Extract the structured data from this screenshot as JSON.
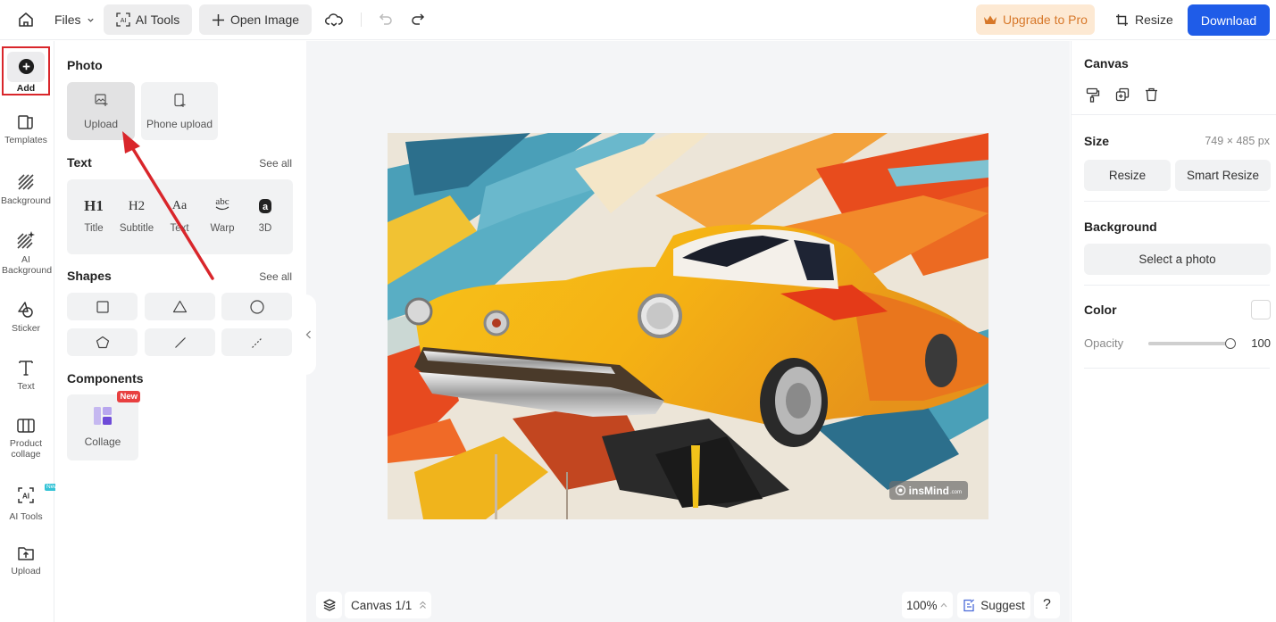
{
  "topbar": {
    "home_icon": "home-icon",
    "files_label": "Files",
    "ai_tools_label": "AI Tools",
    "open_image_label": "Open Image",
    "upgrade_label": "Upgrade to Pro",
    "resize_label": "Resize",
    "download_label": "Download"
  },
  "rail": {
    "items": [
      {
        "label": "Add",
        "icon": "add-circle-icon"
      },
      {
        "label": "Templates",
        "icon": "templates-icon"
      },
      {
        "label": "Background",
        "icon": "background-hatch-icon"
      },
      {
        "label": "AI Background",
        "icon": "ai-background-icon"
      },
      {
        "label": "Sticker",
        "icon": "sticker-icon"
      },
      {
        "label": "Text",
        "icon": "text-icon"
      },
      {
        "label": "Product collage",
        "icon": "product-collage-icon"
      },
      {
        "label": "AI Tools",
        "icon": "ai-tools-icon",
        "badge": "New"
      },
      {
        "label": "Upload",
        "icon": "upload-folder-icon"
      }
    ]
  },
  "panel": {
    "photo": {
      "title": "Photo",
      "items": [
        {
          "label": "Upload",
          "icon": "image-upload-icon"
        },
        {
          "label": "Phone upload",
          "icon": "phone-upload-icon"
        }
      ]
    },
    "text": {
      "title": "Text",
      "see_all": "See all",
      "items": [
        {
          "glyph": "H1",
          "label": "Title"
        },
        {
          "glyph": "H2",
          "label": "Subtitle"
        },
        {
          "glyph": "Aa",
          "label": "Text"
        },
        {
          "glyph": "abc",
          "label": "Warp"
        },
        {
          "glyph": "a",
          "label": "3D"
        }
      ]
    },
    "shapes": {
      "title": "Shapes",
      "see_all": "See all",
      "items": [
        "square",
        "triangle",
        "circle",
        "pentagon",
        "line",
        "dashed-line"
      ]
    },
    "components": {
      "title": "Components",
      "items": [
        {
          "label": "Collage",
          "badge": "New"
        }
      ]
    }
  },
  "canvas": {
    "watermark": "insMind",
    "watermark_suffix": ".com",
    "page_label": "Canvas 1/1",
    "zoom_label": "100%",
    "suggest_label": "Suggest",
    "help_label": "?"
  },
  "right_panel": {
    "canvas_title": "Canvas",
    "size_title": "Size",
    "size_value": "749 × 485 px",
    "resize_label": "Resize",
    "smart_resize_label": "Smart Resize",
    "background_title": "Background",
    "select_photo_label": "Select a photo",
    "color_title": "Color",
    "color_value": "#ffffff",
    "opacity_label": "Opacity",
    "opacity_value": "100",
    "opacity_percent": 100
  },
  "colors": {
    "accent": "#1f5ce8",
    "upgrade_bg": "#fde9d3",
    "upgrade_text": "#d7782a",
    "annotation_red": "#d9262b",
    "new_badge": "#e84040"
  }
}
